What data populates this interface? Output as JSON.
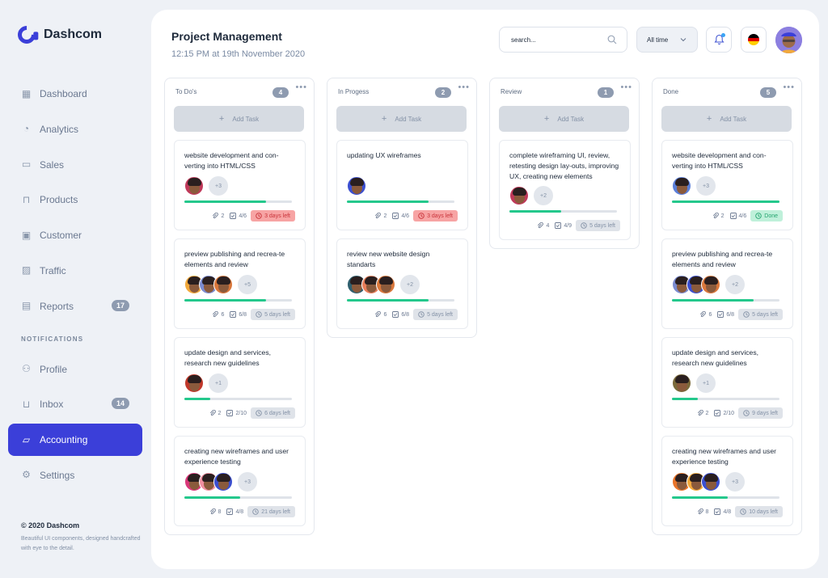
{
  "app": {
    "name": "Dashcom"
  },
  "nav": {
    "items": [
      {
        "id": "dashboard",
        "label": "Dashboard",
        "icon": "grid-icon"
      },
      {
        "id": "analytics",
        "label": "Analytics",
        "icon": "pie-chart-icon"
      },
      {
        "id": "sales",
        "label": "Sales",
        "icon": "wallet-icon"
      },
      {
        "id": "products",
        "label": "Products",
        "icon": "bag-icon"
      },
      {
        "id": "customer",
        "label": "Customer",
        "icon": "briefcase-icon"
      },
      {
        "id": "traffic",
        "label": "Traffic",
        "icon": "image-icon"
      },
      {
        "id": "reports",
        "label": "Reports",
        "icon": "document-icon",
        "badge": "17"
      }
    ],
    "section_label": "NOTIFICATIONS",
    "items2": [
      {
        "id": "profile",
        "label": "Profile",
        "icon": "user-icon"
      },
      {
        "id": "inbox",
        "label": "Inbox",
        "icon": "inbox-icon",
        "badge": "14"
      },
      {
        "id": "accounting",
        "label": "Accounting",
        "icon": "folder-icon",
        "active": true
      },
      {
        "id": "settings",
        "label": "Settings",
        "icon": "gear-icon"
      }
    ]
  },
  "footer": {
    "title": "© 2020 Dashcom",
    "text": "Beautiful UI components, designed handcrafted with eye to the detail."
  },
  "header": {
    "title": "Project Management",
    "subtitle": "12:15 PM at 19th November 2020",
    "search_placeholder": "search...",
    "filter_label": "All time"
  },
  "colors": {
    "accent": "#3b3fd9",
    "progress": "#24c88c"
  },
  "columns": [
    {
      "name": "To Do's",
      "count": "4",
      "add_label": "Add Task",
      "cards": [
        {
          "title": "website development and con-verting into HTML/CSS",
          "avatars": [
            "#c0395a"
          ],
          "more": "+3",
          "progress": 0.76,
          "attachments": "2",
          "checks": "4/6",
          "due": "3 days left",
          "due_style": "red"
        },
        {
          "title": "preview publishing and recrea-te elements and review",
          "avatars": [
            "#f2a93b",
            "#7b8bd0",
            "#d9773b"
          ],
          "more": "+5",
          "progress": 0.76,
          "attachments": "6",
          "checks": "6/8",
          "due": "5 days left",
          "due_style": "grey"
        },
        {
          "title": "update design and services, research new guidelines",
          "avatars": [
            "#c0392b"
          ],
          "more": "+1",
          "progress": 0.24,
          "attachments": "2",
          "checks": "2/10",
          "due": "6 days left",
          "due_style": "grey"
        },
        {
          "title": "creating new wireframes and user experience testing",
          "avatars": [
            "#d9387a",
            "#f08fa0",
            "#3b4fd0"
          ],
          "more": "+3",
          "progress": 0.52,
          "attachments": "8",
          "checks": "4/8",
          "due": "21 days left",
          "due_style": "grey"
        }
      ]
    },
    {
      "name": "In Progess",
      "count": "2",
      "add_label": "Add Task",
      "cards": [
        {
          "title": "updating UX wireframes",
          "avatars": [
            "#3b4fd0"
          ],
          "more": "",
          "progress": 0.76,
          "attachments": "2",
          "checks": "4/6",
          "due": "3 days left",
          "due_style": "red"
        },
        {
          "title": "review new website design standarts",
          "avatars": [
            "#2f5f6e",
            "#e87e5a",
            "#d9773b"
          ],
          "more": "+2",
          "progress": 0.76,
          "attachments": "6",
          "checks": "6/8",
          "due": "5 days left",
          "due_style": "grey"
        }
      ]
    },
    {
      "name": "Review",
      "count": "1",
      "add_label": "Add Task",
      "cards": [
        {
          "title": "complete wireframing UI, review, retesting design lay-outs, improving UX, creating new elements",
          "avatars": [
            "#c0395a"
          ],
          "more": "+2",
          "progress": 0.48,
          "attachments": "4",
          "checks": "4/9",
          "due": "5 days left",
          "due_style": "grey"
        }
      ]
    },
    {
      "name": "Done",
      "count": "5",
      "add_label": "Add Task",
      "cards": [
        {
          "title": "website development and con-verting into HTML/CSS",
          "avatars": [
            "#5b7fd9"
          ],
          "more": "+3",
          "progress": 1.0,
          "attachments": "2",
          "checks": "4/6",
          "due": "Done",
          "due_style": "green"
        },
        {
          "title": "preview publishing and recrea-te elements and review",
          "avatars": [
            "#7b8bd0",
            "#3b4fd0",
            "#d9773b"
          ],
          "more": "+2",
          "progress": 0.76,
          "attachments": "6",
          "checks": "6/8",
          "due": "5 days left",
          "due_style": "grey"
        },
        {
          "title": "update design and services, research new guidelines",
          "avatars": [
            "#7a6a3b"
          ],
          "more": "+1",
          "progress": 0.24,
          "attachments": "2",
          "checks": "2/10",
          "due": "9 days left",
          "due_style": "grey"
        },
        {
          "title": "creating new wireframes and user experience testing",
          "avatars": [
            "#e8742a",
            "#f2a93b",
            "#3b4fd0"
          ],
          "more": "+3",
          "progress": 0.52,
          "attachments": "8",
          "checks": "4/8",
          "due": "10 days left",
          "due_style": "grey"
        }
      ]
    }
  ]
}
